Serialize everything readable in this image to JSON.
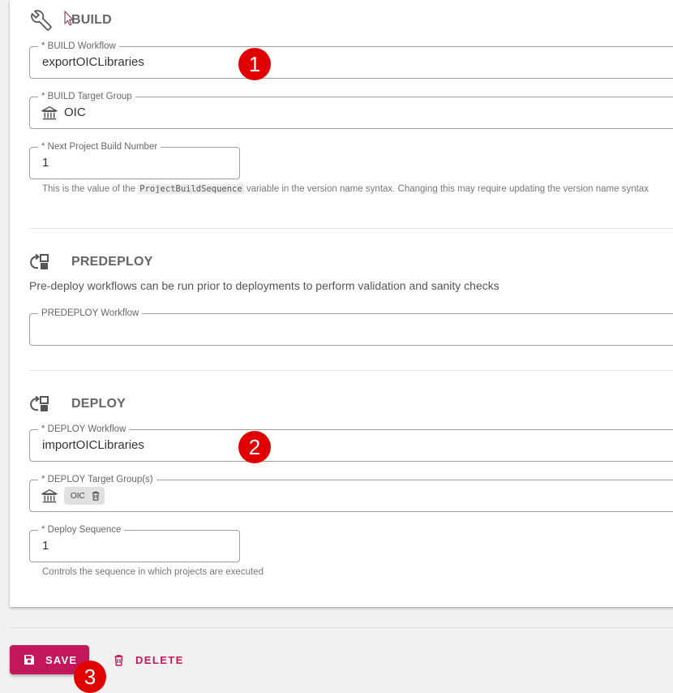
{
  "build": {
    "title": "BUILD",
    "icon": "wrench-icon",
    "workflow": {
      "label": "* BUILD Workflow",
      "value": "exportOICLibraries"
    },
    "target_group": {
      "label": "* BUILD Target Group",
      "value": "OIC",
      "icon": "bank-icon"
    },
    "build_number": {
      "label": "* Next Project Build Number",
      "value": "1",
      "hint_prefix": "This is the value of the ",
      "hint_code": "ProjectBuildSequence",
      "hint_suffix": " variable in the version name syntax. Changing this may require updating the version name syntax"
    }
  },
  "predeploy": {
    "title": "PREDEPLOY",
    "icon": "workflow-sync-icon",
    "description": "Pre-deploy workflows can be run prior to deployments to perform validation and sanity checks",
    "workflow": {
      "label": "PREDEPLOY Workflow",
      "value": ""
    }
  },
  "deploy": {
    "title": "DEPLOY",
    "icon": "workflow-sync-icon",
    "workflow": {
      "label": "* DEPLOY Workflow",
      "value": "importOICLibraries"
    },
    "target_groups": {
      "label": "* DEPLOY Target Group(s)",
      "chips": [
        "OIC"
      ],
      "icon": "bank-icon"
    },
    "sequence": {
      "label": "* Deploy Sequence",
      "value": "1",
      "hint": "Controls the sequence in which projects are executed"
    }
  },
  "actions": {
    "save": "SAVE",
    "delete": "DELETE"
  },
  "annotations": [
    "1",
    "2",
    "3"
  ],
  "colors": {
    "accent": "#c2185b",
    "badge": "#e10000"
  }
}
